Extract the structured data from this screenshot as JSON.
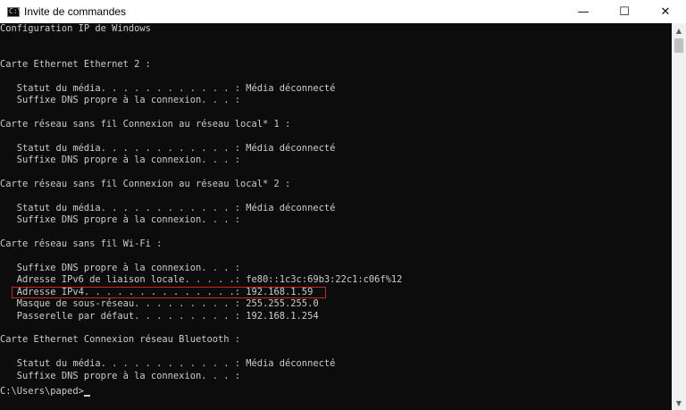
{
  "window": {
    "title": "Invite de commandes",
    "icon": "C:\\",
    "controls": {
      "minimize": "—",
      "maximize": "☐",
      "close": "✕"
    }
  },
  "console": {
    "lines": [
      "Configuration IP de Windows",
      "",
      "",
      "Carte Ethernet Ethernet 2 :",
      "",
      "   Statut du média. . . . . . . . . . . . : Média déconnecté",
      "   Suffixe DNS propre à la connexion. . . :",
      "",
      "Carte réseau sans fil Connexion au réseau local* 1 :",
      "",
      "   Statut du média. . . . . . . . . . . . : Média déconnecté",
      "   Suffixe DNS propre à la connexion. . . :",
      "",
      "Carte réseau sans fil Connexion au réseau local* 2 :",
      "",
      "   Statut du média. . . . . . . . . . . . : Média déconnecté",
      "   Suffixe DNS propre à la connexion. . . :",
      "",
      "Carte réseau sans fil Wi-Fi :",
      "",
      "   Suffixe DNS propre à la connexion. . . :",
      "   Adresse IPv6 de liaison locale. . . . .: fe80::1c3c:69b3:22c1:c06f%12",
      "   Adresse IPv4. . . . . . . . . . . . . .: 192.168.1.59",
      "   Masque de sous-réseau. . . . . . . . . : 255.255.255.0",
      "   Passerelle par défaut. . . . . . . . . : 192.168.1.254",
      "",
      "Carte Ethernet Connexion réseau Bluetooth :",
      "",
      "   Statut du média. . . . . . . . . . . . : Média déconnecté",
      "   Suffixe DNS propre à la connexion. . . :"
    ],
    "prompt": "C:\\Users\\paped>"
  },
  "colors": {
    "background": "#0c0c0c",
    "text": "#cccccc",
    "highlight_border": "#c42b1c"
  }
}
